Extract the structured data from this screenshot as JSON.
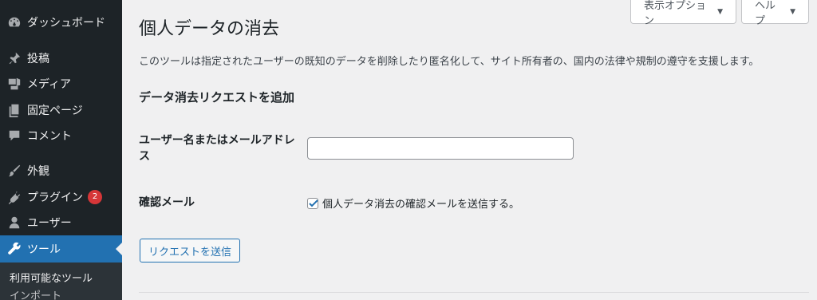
{
  "sidebar": {
    "items": [
      {
        "label": "ダッシュボード",
        "icon": "dashboard-icon"
      },
      {
        "label": "投稿",
        "icon": "pin-icon"
      },
      {
        "label": "メディア",
        "icon": "media-icon"
      },
      {
        "label": "固定ページ",
        "icon": "page-icon"
      },
      {
        "label": "コメント",
        "icon": "comment-icon"
      },
      {
        "label": "外観",
        "icon": "brush-icon"
      },
      {
        "label": "プラグイン",
        "icon": "plugin-icon",
        "badge": "2"
      },
      {
        "label": "ユーザー",
        "icon": "user-icon"
      },
      {
        "label": "ツール",
        "icon": "wrench-icon",
        "active": true
      }
    ],
    "submenu": [
      "利用可能なツール",
      "インポート"
    ]
  },
  "header": {
    "screen_options": "表示オプション",
    "help": "ヘルプ"
  },
  "main": {
    "title": "個人データの消去",
    "description": "このツールは指定されたユーザーの既知のデータを削除したり匿名化して、サイト所有者の、国内の法律や規制の遵守を支援します。",
    "section_title": "データ消去リクエストを追加",
    "username_label": "ユーザー名またはメールアドレス",
    "username_value": "",
    "email_label": "確認メール",
    "confirm_checkbox_label": "個人データ消去の確認メールを送信する。",
    "confirm_checked": true,
    "submit_label": "リクエストを送信"
  },
  "colors": {
    "sidebar_bg": "#1d2327",
    "accent": "#2271b1",
    "badge": "#d63638",
    "page_bg": "#f0f0f1"
  }
}
